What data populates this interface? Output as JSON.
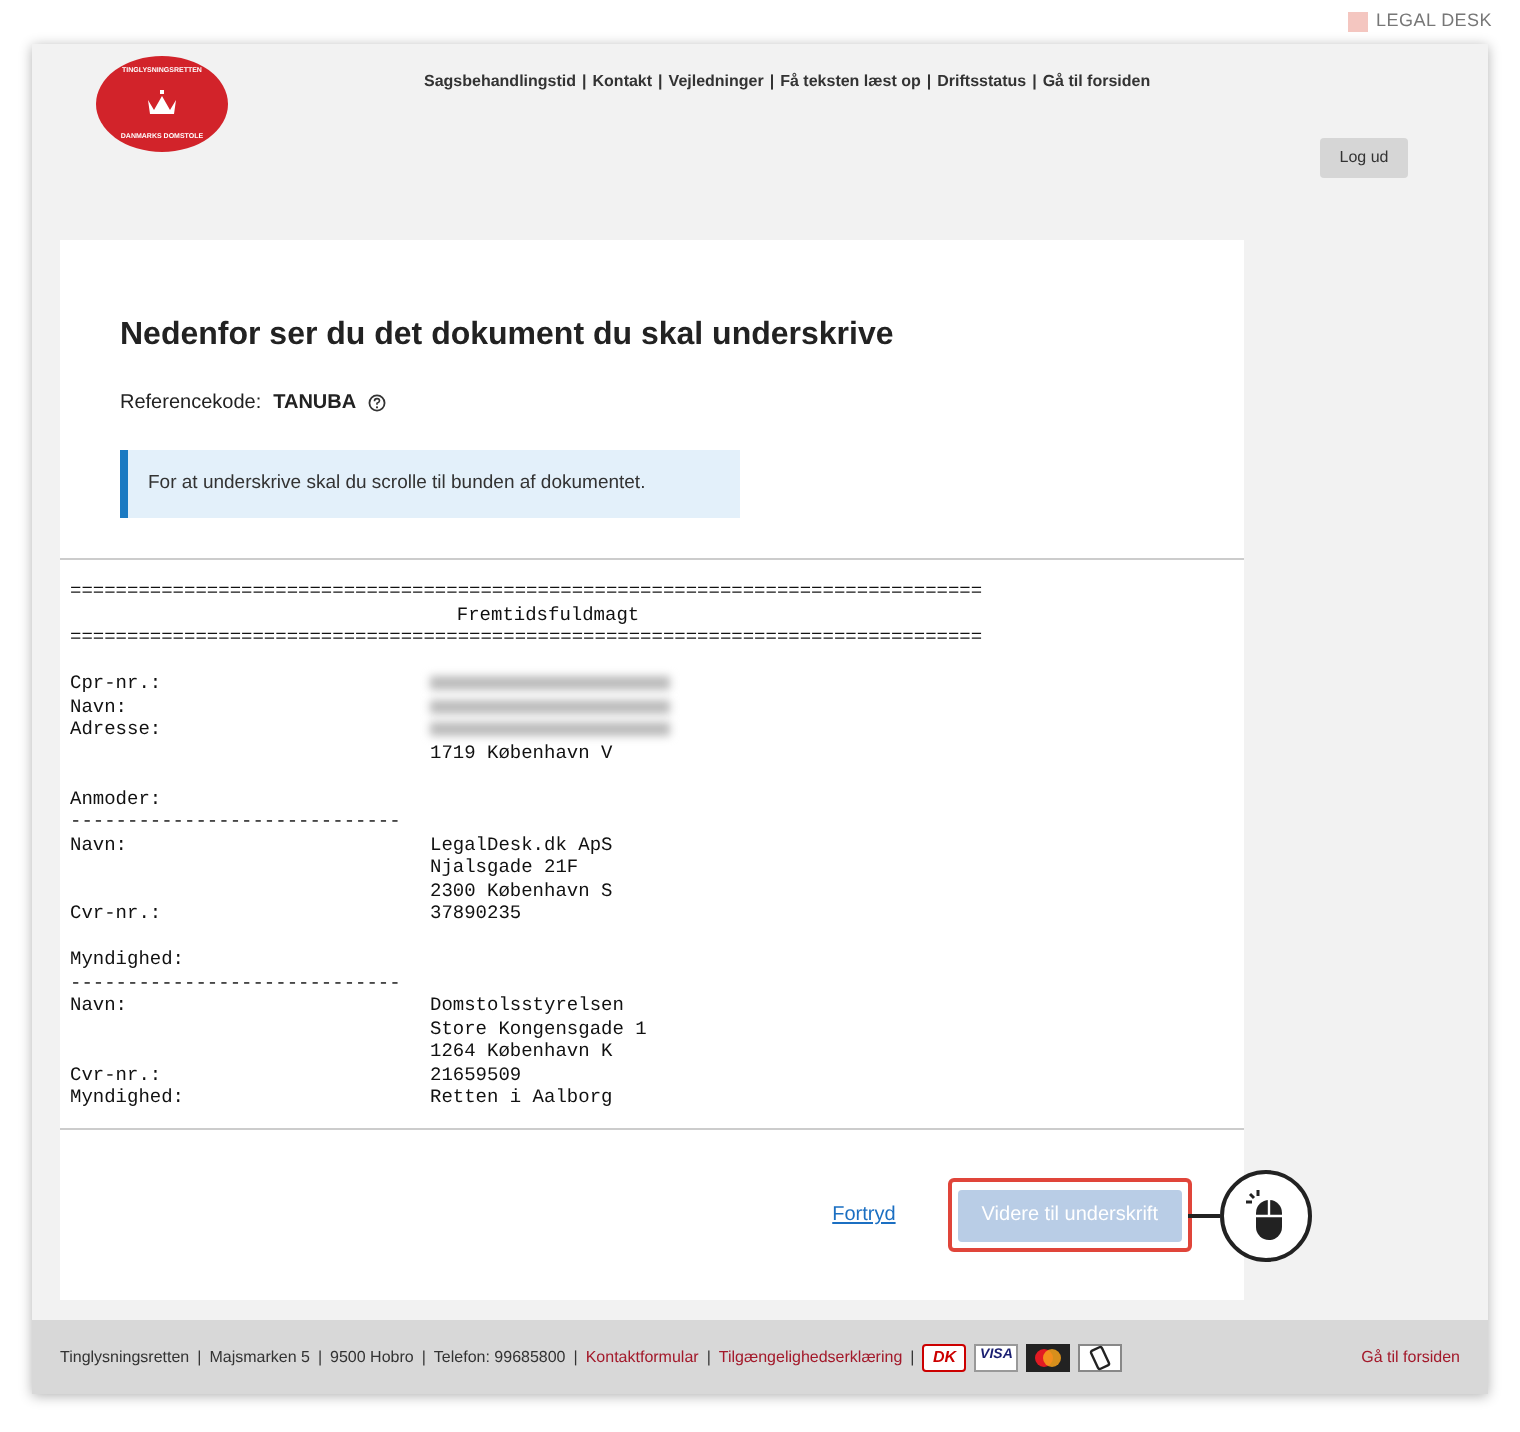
{
  "brand": {
    "label": "LEGAL DESK"
  },
  "header": {
    "logo": {
      "top": "TINGLYSNINGSRETTEN",
      "bottom": "DANMARKS DOMSTOLE"
    },
    "separator": "|",
    "nav": [
      "Sagsbehandlingstid",
      "Kontakt",
      "Vejledninger",
      "Få teksten læst op",
      "Driftsstatus",
      "Gå til forsiden"
    ],
    "logout": "Log ud"
  },
  "page": {
    "title": "Nedenfor ser du det dokument du skal underskrive",
    "reference_label": "Referencekode:",
    "reference_code": "TANUBA",
    "notice": "For at underskrive skal du scrolle til bunden af dokumentet."
  },
  "document": [
    {
      "kind": "rule",
      "text": "================================================================================"
    },
    {
      "kind": "title",
      "text": "Fremtidsfuldmagt"
    },
    {
      "kind": "rule",
      "text": "================================================================================"
    },
    {
      "kind": "blank"
    },
    {
      "kind": "field",
      "label": "Cpr-nr.:",
      "redacted": true
    },
    {
      "kind": "field",
      "label": "Navn:",
      "redacted": true
    },
    {
      "kind": "field",
      "label": "Adresse:",
      "redacted": true
    },
    {
      "kind": "field",
      "value": "1719 København V"
    },
    {
      "kind": "blank"
    },
    {
      "kind": "heading",
      "text": "Anmoder:"
    },
    {
      "kind": "rule",
      "text": "-----------------------------"
    },
    {
      "kind": "field",
      "label": "Navn:",
      "value": "LegalDesk.dk ApS"
    },
    {
      "kind": "field",
      "value": "Njalsgade 21F"
    },
    {
      "kind": "field",
      "value": "2300 København S"
    },
    {
      "kind": "field",
      "label": "Cvr-nr.:",
      "value": "37890235"
    },
    {
      "kind": "blank"
    },
    {
      "kind": "heading",
      "text": "Myndighed:"
    },
    {
      "kind": "rule",
      "text": "-----------------------------"
    },
    {
      "kind": "field",
      "label": "Navn:",
      "value": "Domstolsstyrelsen"
    },
    {
      "kind": "field",
      "value": "Store Kongensgade 1"
    },
    {
      "kind": "field",
      "value": "1264 København K"
    },
    {
      "kind": "field",
      "label": "Cvr-nr.:",
      "value": "21659509"
    },
    {
      "kind": "field",
      "label": "Myndighed:",
      "value": "Retten i Aalborg"
    }
  ],
  "actions": {
    "cancel": "Fortryd",
    "continue": {
      "label": "Videre til underskrift",
      "disabled": true,
      "highlighted": true
    }
  },
  "footer": {
    "separator": "|",
    "info": [
      "Tinglysningsretten",
      "Majsmarken 5",
      "9500 Hobro",
      "Telefon: 99685800"
    ],
    "links": [
      "Kontaktformular",
      "Tilgængelighedserklæring"
    ],
    "cards": [
      {
        "kind": "dk",
        "label": "DK"
      },
      {
        "kind": "visa",
        "label": "VISA"
      },
      {
        "kind": "mastercard"
      },
      {
        "kind": "mobile"
      }
    ],
    "home": "Gå til forsiden"
  }
}
